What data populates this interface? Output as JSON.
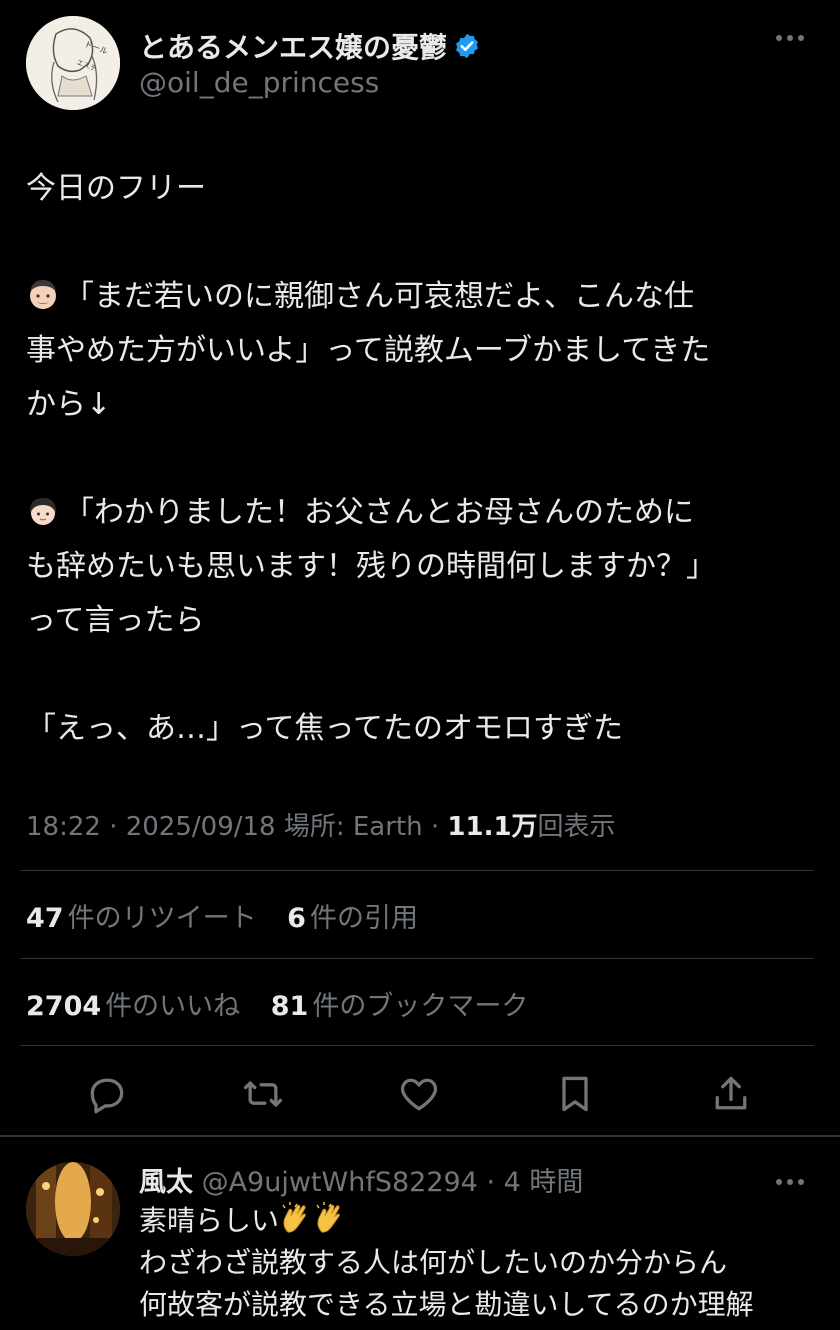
{
  "author": {
    "display_name": "とあるメンエス嬢の憂鬱",
    "handle": "@oil_de_princess",
    "verified": true,
    "avatar_text": "ドールをエステする"
  },
  "post": {
    "lines": [
      "今日のフリー",
      "",
      "「まだ若いのに親御さん可哀想だよ、こんな仕",
      "事やめた方がいいよ」って説教ムーブかましてきた",
      "から↓",
      "",
      "「わかりました！お父さんとお母さんのために",
      "も辞めたいも思います！残りの時間何しますか？」",
      "って言ったら",
      "",
      "「えっ、あ…」って焦ってたのオモロすぎた"
    ],
    "emoji_line_2": "man-face-emoji",
    "emoji_line_6": "girl-face-emoji"
  },
  "meta": {
    "time_date_location": "18:22 · 2025/09/18 場所: Earth · ",
    "views_number": "11.1万",
    "views_label": "回表示"
  },
  "stats": {
    "retweets_number": "47",
    "retweets_label": "件のリツイート",
    "quotes_number": "6",
    "quotes_label": "件の引用",
    "likes_number": "2704",
    "likes_label": "件のいいね",
    "bookmarks_number": "81",
    "bookmarks_label": "件のブックマーク"
  },
  "actions": [
    "reply-icon",
    "retweet-icon",
    "like-icon",
    "bookmark-icon",
    "share-icon"
  ],
  "reply": {
    "display_name": "風太",
    "handle_time": " @A9ujwtWhfS82294 · 4 時間",
    "line1": "素晴らしい",
    "line2": "わざわざ説教する人は何がしたいのか分からん",
    "line3": "何故客が説教できる立場と勘違いしてるのか理解"
  },
  "colors": {
    "background": "#000000",
    "text": "#e7e9ea",
    "secondary": "#71767b",
    "divider": "#2f3336",
    "verified_blue": "#1d9bf0"
  }
}
